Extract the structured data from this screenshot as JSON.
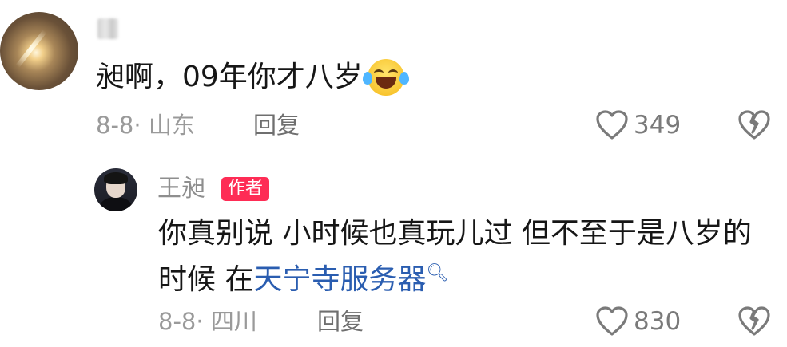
{
  "comment": {
    "text": "昶啊，09年你才八岁",
    "emoji": "laugh-cry-emoji",
    "date": "8-8",
    "separator": "·",
    "location": "山东",
    "reply_label": "回复",
    "likes": "349"
  },
  "reply": {
    "username": "王昶",
    "badge": "作者",
    "text_before_link": "你真别说 小时候也真玩儿过 但不至于是八岁的时候 在",
    "link_text": "天宁寺服务器",
    "date": "8-8",
    "separator": "·",
    "location": "四川",
    "reply_label": "回复",
    "likes": "830"
  },
  "icons": {
    "like": "heart-outline-icon",
    "dislike": "broken-heart-icon",
    "search": "search-icon"
  },
  "colors": {
    "badge": "#fe2c55",
    "link": "#2a5db0",
    "meta": "#9a9a9a"
  }
}
